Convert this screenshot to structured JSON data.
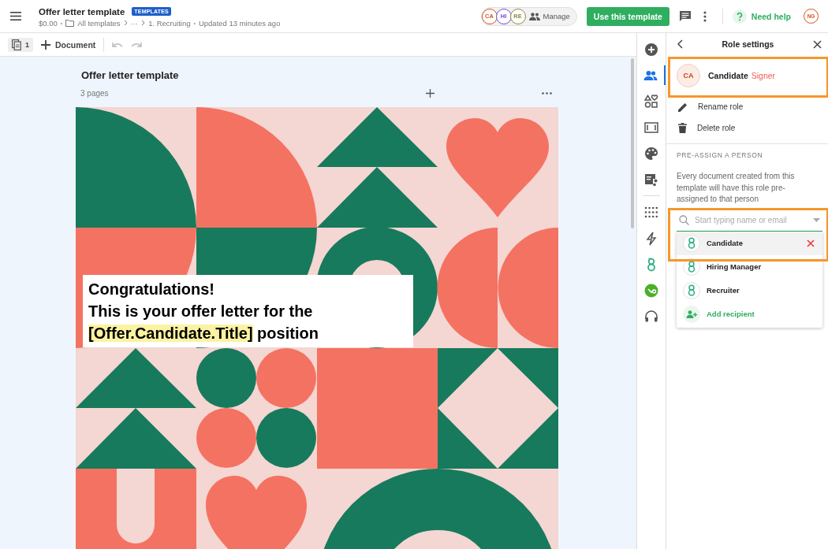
{
  "header": {
    "title": "Offer letter template",
    "badge": "TEMPLATES",
    "price": "$0.00",
    "sep1": "•",
    "crumbs": [
      "All templates",
      "···",
      "1. Recruiting"
    ],
    "sep2": "•",
    "updated": "Updated 13 minutes ago"
  },
  "collaborators": [
    {
      "initials": "CA",
      "color": "#d9531e"
    },
    {
      "initials": "HI",
      "color": "#6b4fd8"
    },
    {
      "initials": "RE",
      "color": "#8a8a3a"
    }
  ],
  "manage": "Manage",
  "use_template": "Use this template",
  "help": "Need help",
  "user": {
    "initials": "NG",
    "color": "#d9531e"
  },
  "toolbar": {
    "pages": "1",
    "document": "Document"
  },
  "document": {
    "title": "Offer letter template",
    "pages": "3 pages",
    "headline": [
      "Congratulations!",
      "This is your offer letter for the"
    ],
    "token": "[Offer.Candidate.Title]",
    "tail": " position"
  },
  "rail": [
    {
      "kind": "add",
      "selected": false
    },
    {
      "kind": "people",
      "selected": true
    },
    {
      "kind": "shapes",
      "selected": false
    },
    {
      "kind": "frame",
      "selected": false
    },
    {
      "kind": "palette",
      "selected": false
    },
    {
      "kind": "flow",
      "selected": false
    },
    {
      "kind": "grid",
      "selected": false
    },
    {
      "kind": "bolt",
      "selected": false
    },
    {
      "kind": "logo",
      "selected": false
    },
    {
      "kind": "badge",
      "selected": false
    },
    {
      "kind": "headset",
      "selected": false
    }
  ],
  "panel": {
    "title": "Role settings",
    "role": {
      "initials": "CA",
      "name": "Candidate",
      "type": "Signer"
    },
    "actions": [
      {
        "kind": "edit",
        "label": "Rename role"
      },
      {
        "kind": "delete",
        "label": "Delete role"
      }
    ],
    "section": "PRE-ASSIGN A PERSON",
    "description": "Every document created from this template will have this role pre-assigned to that person",
    "search_placeholder": "Start typing name or email",
    "options": [
      {
        "label": "Candidate",
        "selected": true
      },
      {
        "label": "Hiring Manager",
        "selected": false
      },
      {
        "label": "Recruiter",
        "selected": false
      }
    ],
    "add_recipient": "Add recipient"
  }
}
